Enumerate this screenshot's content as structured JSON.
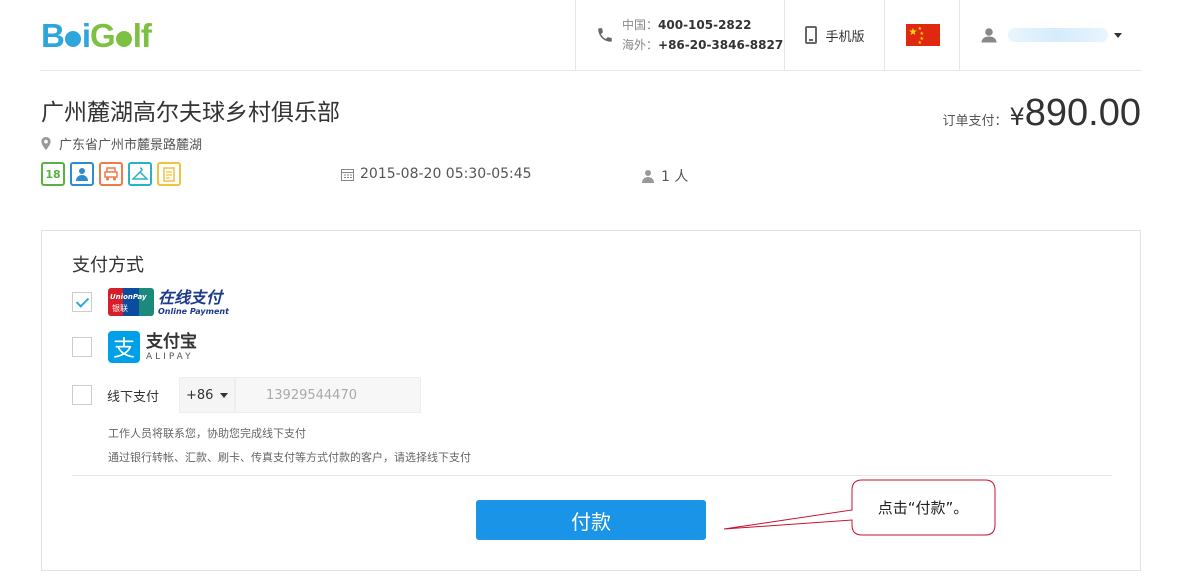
{
  "header": {
    "logo_text": "BaiGolf",
    "phone": {
      "cn_label": "中国：",
      "cn_number": "400-105-2822",
      "overseas_label": "海外：",
      "overseas_number": "+86-20-3846-8827"
    },
    "mobile_label": "手机版",
    "region_flag": "China",
    "colors": {
      "brand_blue": "#2ea6dc",
      "brand_green": "#7dc142"
    }
  },
  "order": {
    "club_name": "广州麓湖高尔夫球乡村俱乐部",
    "address": "广东省广州市麓景路麓湖",
    "features": [
      "18-holes-icon",
      "caddie-icon",
      "cart-icon",
      "locker-icon",
      "scorecard-icon"
    ],
    "datetime": "2015-08-20 05:30-05:45",
    "people": "1 人",
    "total_label": "订单支付：",
    "total_currency": "¥",
    "total_amount": "890.00"
  },
  "payment": {
    "title": "支付方式",
    "options": [
      {
        "name": "unionpay",
        "checked": true,
        "text_cn": "在线支付",
        "text_en": "Online Payment",
        "logo_top": "UnionPay",
        "logo_bottom": "银联"
      },
      {
        "name": "alipay",
        "checked": false,
        "text_cn": "支付宝",
        "text_en": "ALIPAY",
        "glyph": "支"
      },
      {
        "name": "offline",
        "checked": false,
        "label": "线下支付",
        "country_code": "+86",
        "phone_value": "13929544470"
      }
    ],
    "notes": [
      "工作人员将联系您，协助您完成线下支付",
      "通过银行转帐、汇款、刷卡、传真支付等方式付款的客户，请选择线下支付"
    ],
    "pay_button": "付款",
    "button_color": "#1a94e6"
  },
  "callout": {
    "text": "点击“付款”。"
  }
}
